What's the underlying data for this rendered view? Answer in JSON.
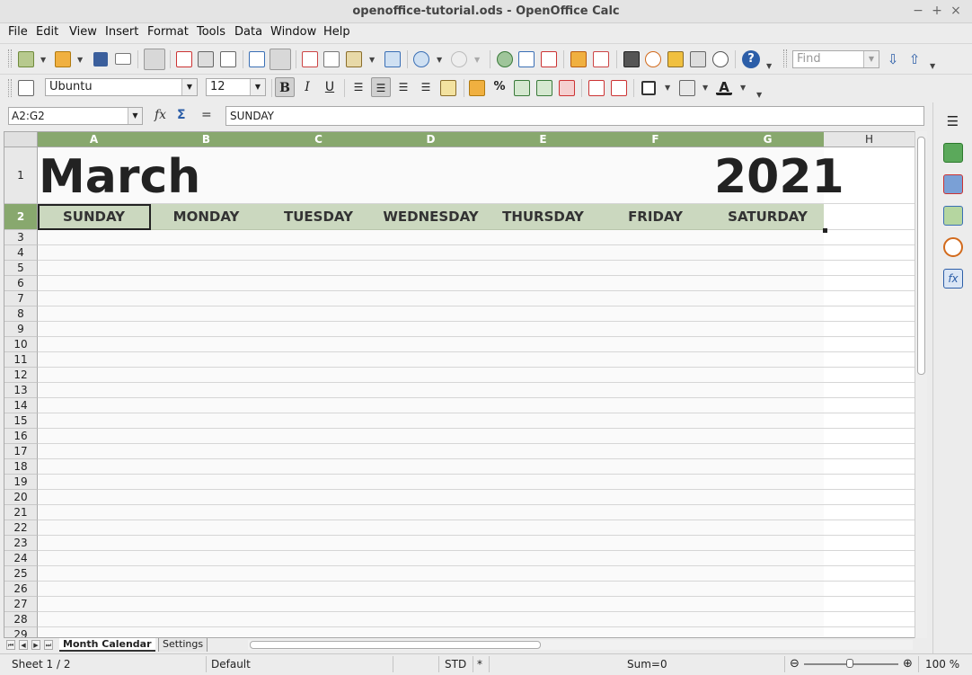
{
  "window": {
    "title": "openoffice-tutorial.ods - OpenOffice Calc",
    "minimize": "−",
    "maximize": "+",
    "close": "×"
  },
  "menu": {
    "items": [
      "File",
      "Edit",
      "View",
      "Insert",
      "Format",
      "Tools",
      "Data",
      "Window",
      "Help"
    ]
  },
  "toolbar": {
    "find_placeholder": "Find"
  },
  "format_toolbar": {
    "font_name": "Ubuntu",
    "font_size": "12",
    "bold": "B",
    "italic": "I",
    "underline": "U",
    "percent": "%"
  },
  "formula_bar": {
    "cell_reference": "A2:G2",
    "fx": "fx",
    "sum": "Σ",
    "equals": "=",
    "content": "SUNDAY"
  },
  "sheet": {
    "columns": [
      "A",
      "B",
      "C",
      "D",
      "E",
      "F",
      "G",
      "H"
    ],
    "selected_columns": [
      "A",
      "B",
      "C",
      "D",
      "E",
      "F",
      "G"
    ],
    "rows": [
      "1",
      "2",
      "3",
      "4",
      "5",
      "6",
      "7",
      "8",
      "9",
      "10",
      "11",
      "12",
      "13",
      "14",
      "15",
      "16",
      "17",
      "18",
      "19",
      "20",
      "21",
      "22",
      "23",
      "24",
      "25",
      "26",
      "27",
      "28",
      "29"
    ],
    "month": "March",
    "year": "2021",
    "days": [
      "SUNDAY",
      "MONDAY",
      "TUESDAY",
      "WEDNESDAY",
      "THURSDAY",
      "FRIDAY",
      "SATURDAY"
    ],
    "header_color": "#88a86e",
    "day_row_color": "#cbd8bf"
  },
  "tabs": {
    "active": "Month Calendar",
    "other": "Settings"
  },
  "status": {
    "sheet": "Sheet 1 / 2",
    "page_style": "Default",
    "mode": "STD",
    "modified": "*",
    "sum": "Sum=0",
    "zoom": "100 %"
  }
}
